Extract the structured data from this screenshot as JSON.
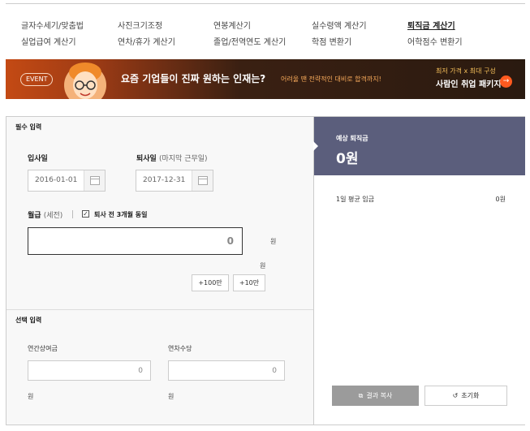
{
  "nav": {
    "items": [
      {
        "label": "글자수세기/맞춤법"
      },
      {
        "label": "사진크기조정"
      },
      {
        "label": "연봉계산기"
      },
      {
        "label": "실수령액 계산기"
      },
      {
        "label": "퇴직금 계산기"
      },
      {
        "label": "실업급여 계산기"
      },
      {
        "label": "연차/휴가 계산기"
      },
      {
        "label": "졸업/전역연도 계산기"
      },
      {
        "label": "학점 변환기"
      },
      {
        "label": "어학점수 변환기"
      }
    ],
    "active_label": "퇴직금 계산기"
  },
  "banner": {
    "badge": "EVENT",
    "headline": "요즘 기업들이 진짜 원하는 인재는?",
    "sub": "어려울 땐 전략적인 대비로 합격까지!",
    "right_top": "최저 가격 x 최대 구성",
    "right_main": "사람인 취업 패키지",
    "arrow": "→"
  },
  "form": {
    "required_title": "필수 입력",
    "start_label": "입사일",
    "end_label": "퇴사일",
    "end_note": "(마지막 근무일)",
    "start_date": "2016-01-01",
    "end_date": "2017-12-31",
    "salary_label": "월급",
    "salary_note": "(세전)",
    "same_three_months": "퇴사 전 3개월 동일",
    "checkbox_mark": "✓",
    "salary_value": "0",
    "unit_won": "원",
    "add_100": "+100만",
    "add_10": "+10만",
    "optional_title": "선택 입력",
    "bonus_label": "연간상여금",
    "bonus_value": "0",
    "leave_label": "연차수당",
    "leave_value": "0"
  },
  "result": {
    "title": "예상 퇴직금",
    "amount": "0원",
    "daily_label": "1일 평균 임금",
    "daily_value": "0원",
    "copy_button": "결과 복사",
    "reset_button": "초기화",
    "copy_icon": "⧉",
    "reset_icon": "↺"
  },
  "colors": {
    "result_header": "#5b5e7c",
    "copy_button": "#9b9b9b",
    "banner_accent": "#ff5a1f"
  }
}
